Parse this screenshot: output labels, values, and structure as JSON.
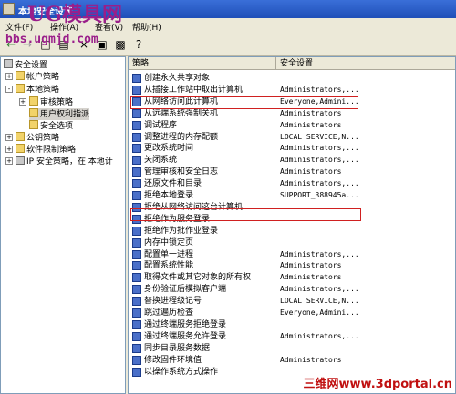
{
  "window": {
    "title": "本地安全设置"
  },
  "watermarks": {
    "top": "UG模具网",
    "url": "bbs.ugmjd.com",
    "bottom": "三维网www.3dportal.cn"
  },
  "menu": [
    "文件(F)",
    "操作(A)",
    "查看(V)",
    "帮助(H)"
  ],
  "tree": {
    "root": "安全设置",
    "items": [
      {
        "label": "帐户策略",
        "level": 1,
        "icon": "folder-icon",
        "expander": "+"
      },
      {
        "label": "本地策略",
        "level": 1,
        "icon": "folder-icon",
        "expander": "-"
      },
      {
        "label": "审核策略",
        "level": 2,
        "icon": "folder-icon",
        "expander": "+"
      },
      {
        "label": "用户权利指派",
        "level": 2,
        "icon": "folder-icon",
        "selected": true
      },
      {
        "label": "安全选项",
        "level": 2,
        "icon": "folder-icon"
      },
      {
        "label": "公钥策略",
        "level": 1,
        "icon": "folder-icon",
        "expander": "+"
      },
      {
        "label": "软件限制策略",
        "level": 1,
        "icon": "folder-icon",
        "expander": "+"
      },
      {
        "label": "IP 安全策略，在 本地计",
        "level": 1,
        "icon": "shield-icon",
        "expander": "+"
      }
    ]
  },
  "columns": {
    "policy": "策略",
    "setting": "安全设置"
  },
  "policies": [
    {
      "name": "创建永久共享对象",
      "setting": ""
    },
    {
      "name": "从插接工作站中取出计算机",
      "setting": "Administrators,..."
    },
    {
      "name": "从网络访问此计算机",
      "setting": "Everyone,Admini..."
    },
    {
      "name": "从远端系统强制关机",
      "setting": "Administrators"
    },
    {
      "name": "调试程序",
      "setting": "Administrators"
    },
    {
      "name": "调整进程的内存配额",
      "setting": "LOCAL SERVICE,N..."
    },
    {
      "name": "更改系统时间",
      "setting": "Administrators,..."
    },
    {
      "name": "关闭系统",
      "setting": "Administrators,..."
    },
    {
      "name": "管理审核和安全日志",
      "setting": "Administrators"
    },
    {
      "name": "还原文件和目录",
      "setting": "Administrators,..."
    },
    {
      "name": "拒绝本地登录",
      "setting": "SUPPORT_388945a..."
    },
    {
      "name": "拒绝从网络访问这台计算机",
      "setting": ""
    },
    {
      "name": "拒绝作为服务登录",
      "setting": ""
    },
    {
      "name": "拒绝作为批作业登录",
      "setting": ""
    },
    {
      "name": "内存中锁定页",
      "setting": ""
    },
    {
      "name": "配置单一进程",
      "setting": "Administrators,..."
    },
    {
      "name": "配置系统性能",
      "setting": "Administrators"
    },
    {
      "name": "取得文件或其它对象的所有权",
      "setting": "Administrators"
    },
    {
      "name": "身份验证后模拟客户端",
      "setting": "Administrators,..."
    },
    {
      "name": "替换进程级记号",
      "setting": "LOCAL SERVICE,N..."
    },
    {
      "name": "跳过遍历检查",
      "setting": "Everyone,Admini..."
    },
    {
      "name": "通过终端服务拒绝登录",
      "setting": ""
    },
    {
      "name": "通过终端服务允许登录",
      "setting": "Administrators,..."
    },
    {
      "name": "同步目录服务数据",
      "setting": ""
    },
    {
      "name": "修改固件环境值",
      "setting": "Administrators"
    },
    {
      "name": "以操作系统方式操作",
      "setting": ""
    }
  ],
  "colors": {
    "highlight_box": "#d02020",
    "titlebar": "#2556c4"
  }
}
